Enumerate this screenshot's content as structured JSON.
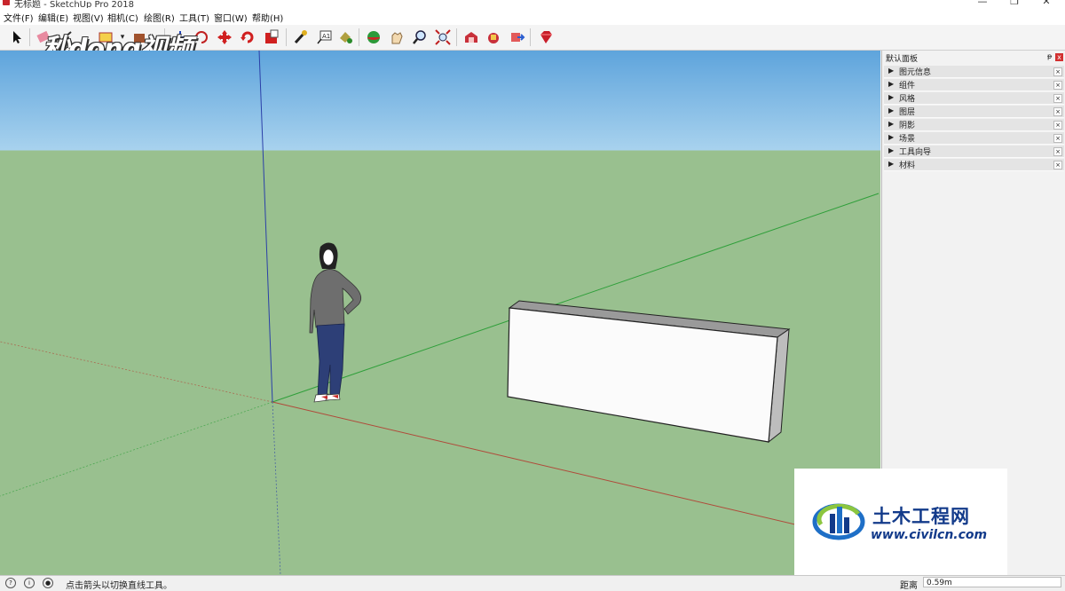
{
  "window": {
    "title": "无标题 - SketchUp Pro 2018",
    "controls": [
      "—",
      "❐",
      "✕"
    ]
  },
  "menu": [
    "文件(F)",
    "编辑(E)",
    "视图(V)",
    "相机(C)",
    "绘图(R)",
    "工具(T)",
    "窗口(W)",
    "帮助(H)"
  ],
  "toolbar": {
    "icons": [
      "select-icon",
      "eraser-icon",
      "line-icon",
      "rectangle-icon",
      "push-pull-icon",
      "move-icon",
      "rotate-icon",
      "scale-icon",
      "paint-icon",
      "tape-measure-icon",
      "text-icon",
      "paint-bucket-icon",
      "orbit-icon",
      "pan-icon",
      "zoom-icon",
      "zoom-extents-icon",
      "warehouse-icon",
      "extension-icon",
      "share-icon",
      "ruby-icon"
    ]
  },
  "watermark": "秒dong视频",
  "tray": {
    "title": "默认面板",
    "pin": "ᵽ",
    "close": "x",
    "panels": [
      {
        "label": "图元信息"
      },
      {
        "label": "组件"
      },
      {
        "label": "风格"
      },
      {
        "label": "图层"
      },
      {
        "label": "阴影"
      },
      {
        "label": "场景"
      },
      {
        "label": "工具向导"
      },
      {
        "label": "材料"
      }
    ]
  },
  "status": {
    "message": "点击箭头以切换直线工具。",
    "measure_label": "距离",
    "measure_value": "0.59m"
  },
  "logo": {
    "name": "土木工程网",
    "url": "www.civilcn.com"
  },
  "colors": {
    "sky_top": "#5ea4dc",
    "ground": "#99c08f",
    "red_axis": "#b04a3a",
    "green_axis": "#2f9f3a",
    "blue_axis": "#2a3fa8",
    "logo_blue": "#123a8a"
  }
}
